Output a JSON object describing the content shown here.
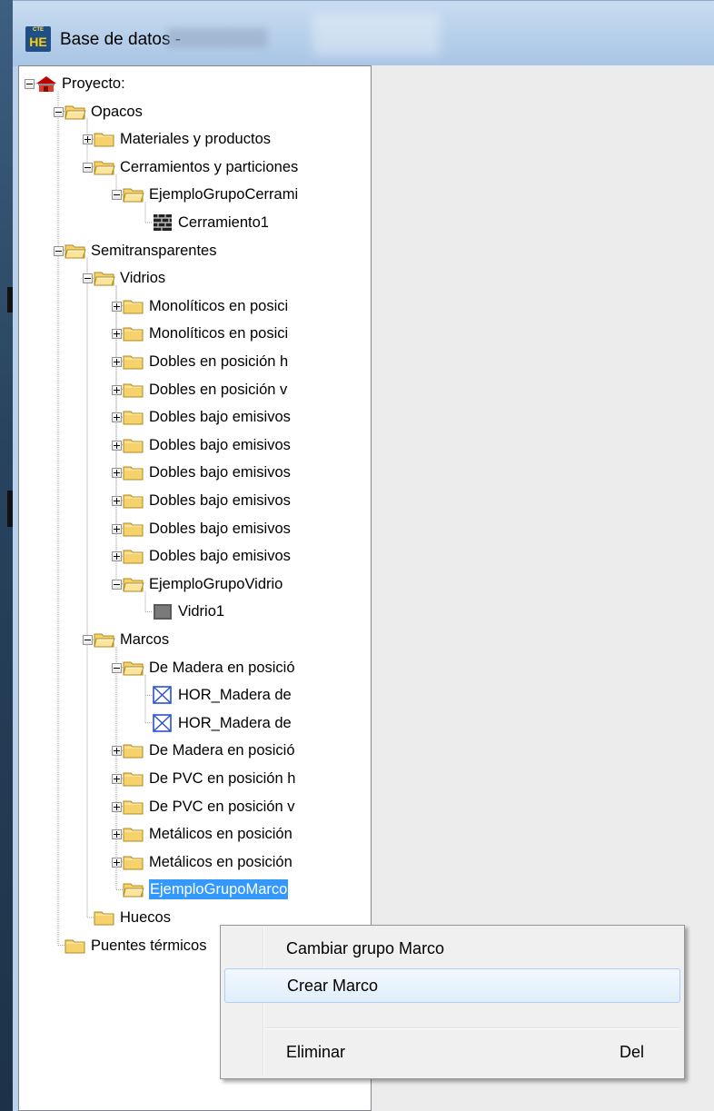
{
  "window": {
    "title": "Base de datos -",
    "logo_top": "CTE",
    "logo_main": "HE"
  },
  "tree": {
    "nodes": [
      {
        "label": "Proyecto:",
        "icon": "house-icon"
      },
      {
        "label": "Opacos",
        "icon": "folder-open-icon"
      },
      {
        "label": "Materiales y productos",
        "icon": "folder-icon"
      },
      {
        "label": "Cerramientos y particiones",
        "icon": "folder-open-icon"
      },
      {
        "label": "EjemploGrupoCerrami",
        "icon": "folder-open-icon"
      },
      {
        "label": "Cerramiento1",
        "icon": "wall-icon"
      },
      {
        "label": "Semitransparentes",
        "icon": "folder-open-icon"
      },
      {
        "label": "Vidrios",
        "icon": "folder-open-icon"
      },
      {
        "label": "Monolíticos en posici",
        "icon": "folder-icon"
      },
      {
        "label": "Monolíticos en posici",
        "icon": "folder-icon"
      },
      {
        "label": "Dobles en posición h",
        "icon": "folder-icon"
      },
      {
        "label": "Dobles en posición v",
        "icon": "folder-icon"
      },
      {
        "label": "Dobles bajo emisivos",
        "icon": "folder-icon"
      },
      {
        "label": "Dobles bajo emisivos",
        "icon": "folder-icon"
      },
      {
        "label": "Dobles bajo emisivos",
        "icon": "folder-icon"
      },
      {
        "label": "Dobles bajo emisivos",
        "icon": "folder-icon"
      },
      {
        "label": "Dobles bajo emisivos",
        "icon": "folder-icon"
      },
      {
        "label": "Dobles bajo emisivos",
        "icon": "folder-icon"
      },
      {
        "label": "EjemploGrupoVidrio",
        "icon": "folder-open-icon"
      },
      {
        "label": "Vidrio1",
        "icon": "glass-icon"
      },
      {
        "label": "Marcos",
        "icon": "folder-open-icon"
      },
      {
        "label": "De Madera en posició",
        "icon": "folder-open-icon"
      },
      {
        "label": "HOR_Madera de",
        "icon": "frame-icon"
      },
      {
        "label": "HOR_Madera de",
        "icon": "frame-icon"
      },
      {
        "label": "De Madera en posició",
        "icon": "folder-icon"
      },
      {
        "label": "De PVC en posición h",
        "icon": "folder-icon"
      },
      {
        "label": "De PVC en posición v",
        "icon": "folder-icon"
      },
      {
        "label": "Metálicos en posición",
        "icon": "folder-icon"
      },
      {
        "label": "Metálicos en posición",
        "icon": "folder-icon"
      },
      {
        "label": "EjemploGrupoMarco",
        "icon": "folder-open-icon",
        "selected": true
      },
      {
        "label": "Huecos",
        "icon": "folder-icon"
      },
      {
        "label": "Puentes térmicos",
        "icon": "folder-icon"
      }
    ]
  },
  "context_menu": {
    "items": [
      {
        "label": "Cambiar grupo Marco",
        "shortcut": ""
      },
      {
        "label": "Crear Marco",
        "shortcut": "",
        "highlighted": true
      },
      {
        "label": "Eliminar",
        "shortcut": "Del"
      }
    ]
  },
  "colors": {
    "selection": "#3399ff",
    "folder": "#f5d26b",
    "frame_icon": "#2a4fd6"
  }
}
